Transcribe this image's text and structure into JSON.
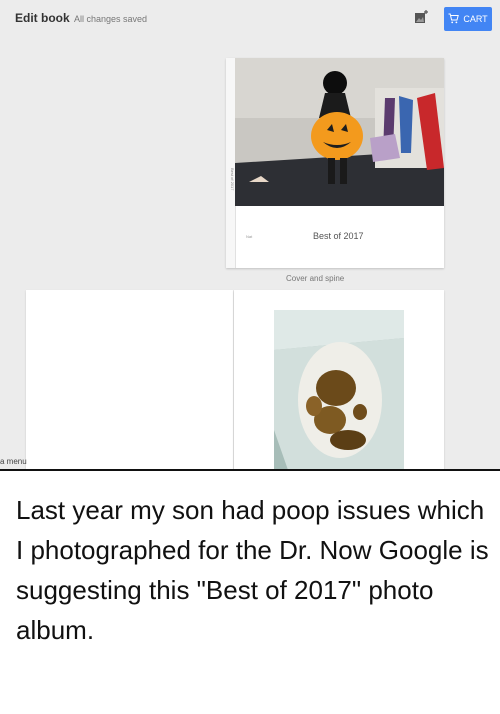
{
  "header": {
    "title": "Edit book",
    "status": "All changes saved",
    "add_photo_icon": "add-photo-icon",
    "cart_label": "CART",
    "cart_icon": "cart-icon",
    "accent_color": "#4285f4"
  },
  "book": {
    "spine_text": "Best of 2017",
    "title": "Best of 2017",
    "tiny_label": "Nat",
    "cover_label": "Cover and spine"
  },
  "sidebar": {
    "menu_fragment": "a menu"
  },
  "caption": {
    "text": "Last year my son had poop issues which I photographed for the Dr. Now Google is suggesting this \"Best of 2017\" photo album."
  }
}
